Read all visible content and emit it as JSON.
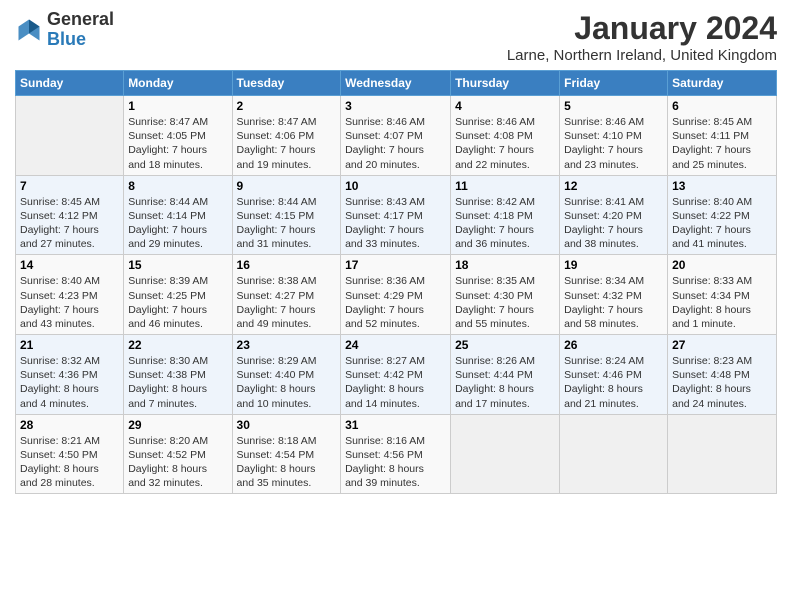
{
  "logo": {
    "general": "General",
    "blue": "Blue"
  },
  "title": "January 2024",
  "location": "Larne, Northern Ireland, United Kingdom",
  "days_of_week": [
    "Sunday",
    "Monday",
    "Tuesday",
    "Wednesday",
    "Thursday",
    "Friday",
    "Saturday"
  ],
  "weeks": [
    [
      {
        "day": "",
        "content": ""
      },
      {
        "day": "1",
        "content": "Sunrise: 8:47 AM\nSunset: 4:05 PM\nDaylight: 7 hours\nand 18 minutes."
      },
      {
        "day": "2",
        "content": "Sunrise: 8:47 AM\nSunset: 4:06 PM\nDaylight: 7 hours\nand 19 minutes."
      },
      {
        "day": "3",
        "content": "Sunrise: 8:46 AM\nSunset: 4:07 PM\nDaylight: 7 hours\nand 20 minutes."
      },
      {
        "day": "4",
        "content": "Sunrise: 8:46 AM\nSunset: 4:08 PM\nDaylight: 7 hours\nand 22 minutes."
      },
      {
        "day": "5",
        "content": "Sunrise: 8:46 AM\nSunset: 4:10 PM\nDaylight: 7 hours\nand 23 minutes."
      },
      {
        "day": "6",
        "content": "Sunrise: 8:45 AM\nSunset: 4:11 PM\nDaylight: 7 hours\nand 25 minutes."
      }
    ],
    [
      {
        "day": "7",
        "content": "Sunrise: 8:45 AM\nSunset: 4:12 PM\nDaylight: 7 hours\nand 27 minutes."
      },
      {
        "day": "8",
        "content": "Sunrise: 8:44 AM\nSunset: 4:14 PM\nDaylight: 7 hours\nand 29 minutes."
      },
      {
        "day": "9",
        "content": "Sunrise: 8:44 AM\nSunset: 4:15 PM\nDaylight: 7 hours\nand 31 minutes."
      },
      {
        "day": "10",
        "content": "Sunrise: 8:43 AM\nSunset: 4:17 PM\nDaylight: 7 hours\nand 33 minutes."
      },
      {
        "day": "11",
        "content": "Sunrise: 8:42 AM\nSunset: 4:18 PM\nDaylight: 7 hours\nand 36 minutes."
      },
      {
        "day": "12",
        "content": "Sunrise: 8:41 AM\nSunset: 4:20 PM\nDaylight: 7 hours\nand 38 minutes."
      },
      {
        "day": "13",
        "content": "Sunrise: 8:40 AM\nSunset: 4:22 PM\nDaylight: 7 hours\nand 41 minutes."
      }
    ],
    [
      {
        "day": "14",
        "content": "Sunrise: 8:40 AM\nSunset: 4:23 PM\nDaylight: 7 hours\nand 43 minutes."
      },
      {
        "day": "15",
        "content": "Sunrise: 8:39 AM\nSunset: 4:25 PM\nDaylight: 7 hours\nand 46 minutes."
      },
      {
        "day": "16",
        "content": "Sunrise: 8:38 AM\nSunset: 4:27 PM\nDaylight: 7 hours\nand 49 minutes."
      },
      {
        "day": "17",
        "content": "Sunrise: 8:36 AM\nSunset: 4:29 PM\nDaylight: 7 hours\nand 52 minutes."
      },
      {
        "day": "18",
        "content": "Sunrise: 8:35 AM\nSunset: 4:30 PM\nDaylight: 7 hours\nand 55 minutes."
      },
      {
        "day": "19",
        "content": "Sunrise: 8:34 AM\nSunset: 4:32 PM\nDaylight: 7 hours\nand 58 minutes."
      },
      {
        "day": "20",
        "content": "Sunrise: 8:33 AM\nSunset: 4:34 PM\nDaylight: 8 hours\nand 1 minute."
      }
    ],
    [
      {
        "day": "21",
        "content": "Sunrise: 8:32 AM\nSunset: 4:36 PM\nDaylight: 8 hours\nand 4 minutes."
      },
      {
        "day": "22",
        "content": "Sunrise: 8:30 AM\nSunset: 4:38 PM\nDaylight: 8 hours\nand 7 minutes."
      },
      {
        "day": "23",
        "content": "Sunrise: 8:29 AM\nSunset: 4:40 PM\nDaylight: 8 hours\nand 10 minutes."
      },
      {
        "day": "24",
        "content": "Sunrise: 8:27 AM\nSunset: 4:42 PM\nDaylight: 8 hours\nand 14 minutes."
      },
      {
        "day": "25",
        "content": "Sunrise: 8:26 AM\nSunset: 4:44 PM\nDaylight: 8 hours\nand 17 minutes."
      },
      {
        "day": "26",
        "content": "Sunrise: 8:24 AM\nSunset: 4:46 PM\nDaylight: 8 hours\nand 21 minutes."
      },
      {
        "day": "27",
        "content": "Sunrise: 8:23 AM\nSunset: 4:48 PM\nDaylight: 8 hours\nand 24 minutes."
      }
    ],
    [
      {
        "day": "28",
        "content": "Sunrise: 8:21 AM\nSunset: 4:50 PM\nDaylight: 8 hours\nand 28 minutes."
      },
      {
        "day": "29",
        "content": "Sunrise: 8:20 AM\nSunset: 4:52 PM\nDaylight: 8 hours\nand 32 minutes."
      },
      {
        "day": "30",
        "content": "Sunrise: 8:18 AM\nSunset: 4:54 PM\nDaylight: 8 hours\nand 35 minutes."
      },
      {
        "day": "31",
        "content": "Sunrise: 8:16 AM\nSunset: 4:56 PM\nDaylight: 8 hours\nand 39 minutes."
      },
      {
        "day": "",
        "content": ""
      },
      {
        "day": "",
        "content": ""
      },
      {
        "day": "",
        "content": ""
      }
    ]
  ]
}
